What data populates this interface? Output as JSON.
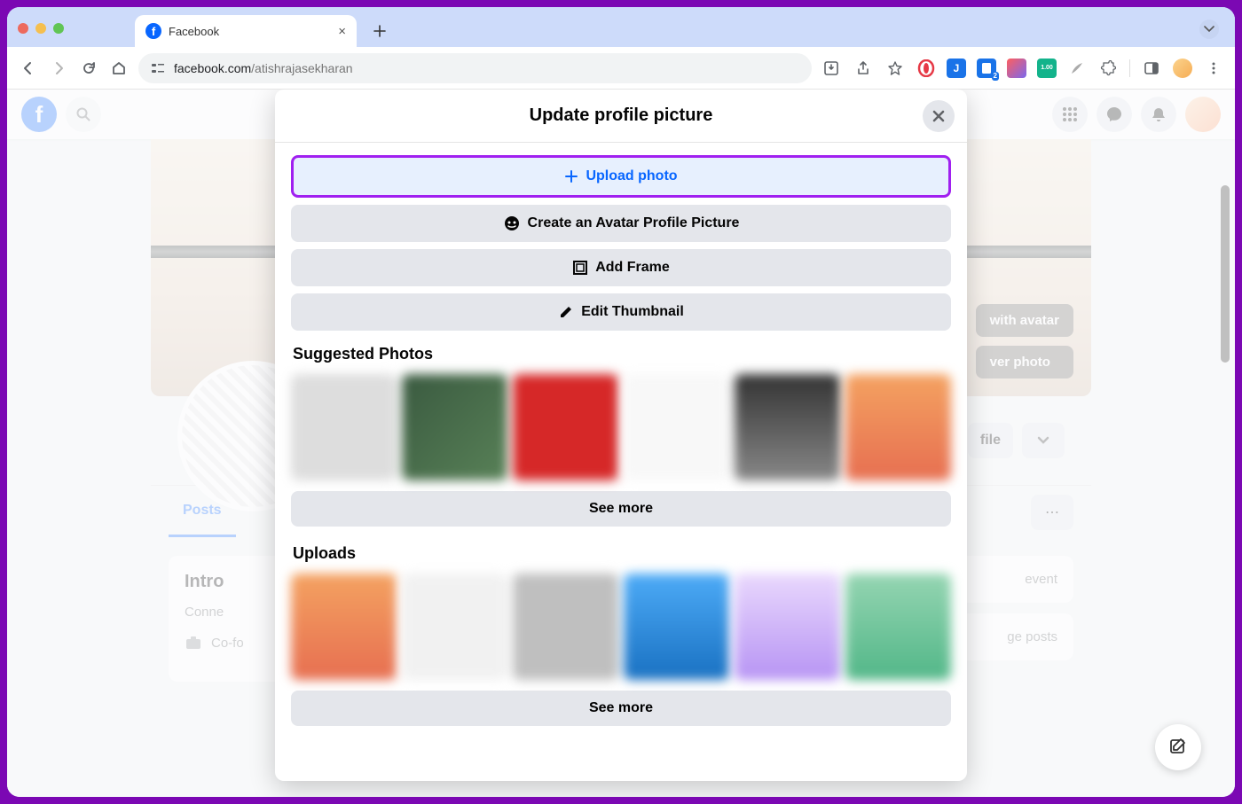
{
  "browser": {
    "tab_title": "Facebook",
    "url_host": "facebook.com",
    "url_path": "/atishrajasekharan"
  },
  "fb": {
    "cover_btn1": "with avatar",
    "cover_btn2": "ver photo",
    "edit_profile": "file",
    "tab_posts": "Posts",
    "intro_title": "Intro",
    "intro_conn": "Conne",
    "intro_cofo": "Co-fo",
    "event": "event",
    "ge_posts": "ge posts"
  },
  "modal": {
    "title": "Update profile picture",
    "upload": "Upload photo",
    "avatar": "Create an Avatar Profile Picture",
    "frame": "Add Frame",
    "thumb": "Edit Thumbnail",
    "suggested": "Suggested Photos",
    "uploads": "Uploads",
    "see_more": "See more"
  },
  "ext_badge": "2",
  "ext_badge2": "1.00"
}
